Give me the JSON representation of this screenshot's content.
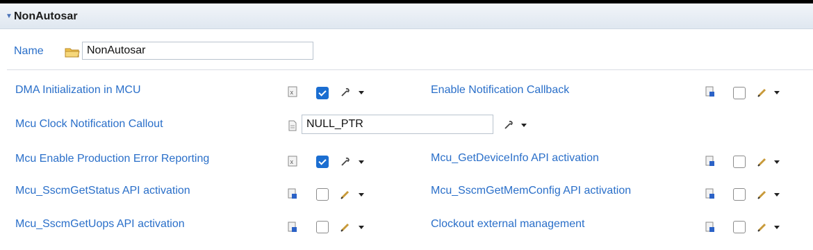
{
  "section": {
    "title": "NonAutosar"
  },
  "name_field": {
    "label": "Name",
    "value": "NonAutosar"
  },
  "params": [
    {
      "label": "DMA Initialization in MCU",
      "checked": true,
      "mode": "calc"
    },
    {
      "label": "Enable Notification Callback",
      "checked": false,
      "mode": "edit"
    },
    {
      "label": "Mcu Clock Notification Callout",
      "value": "NULL_PTR",
      "mode": "calc"
    },
    {
      "label": "Mcu Enable Production Error Reporting",
      "checked": true,
      "mode": "calc"
    },
    {
      "label": "Mcu_GetDeviceInfo API activation",
      "checked": false,
      "mode": "edit"
    },
    {
      "label": "Mcu_SscmGetStatus API activation",
      "checked": false,
      "mode": "edit"
    },
    {
      "label": "Mcu_SscmGetMemConfig API activation",
      "checked": false,
      "mode": "edit"
    },
    {
      "label": "Mcu_SscmGetUops API activation",
      "checked": false,
      "mode": "edit"
    },
    {
      "label": "Clockout external management",
      "checked": false,
      "mode": "edit"
    }
  ],
  "colors": {
    "label": "#2a6fc9",
    "checked": "#1b6ed1"
  }
}
